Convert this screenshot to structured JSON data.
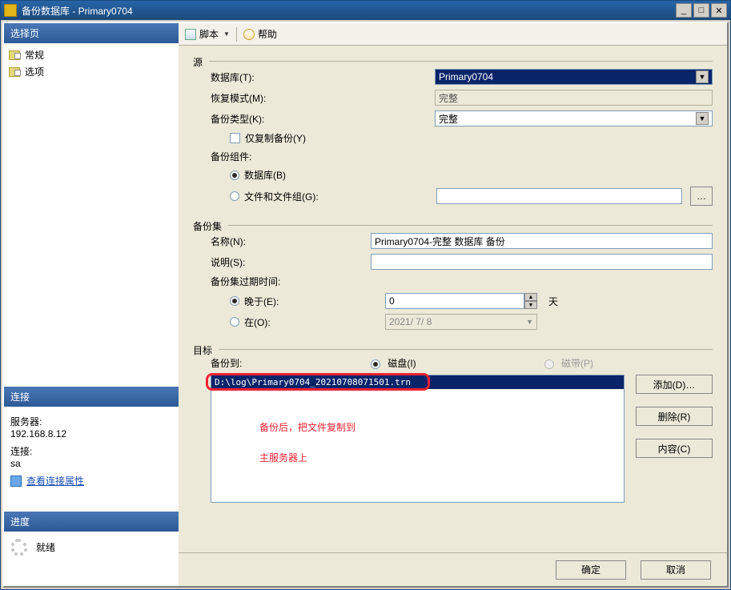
{
  "title": "备份数据库 - Primary0704",
  "toolbar": {
    "script_label": "脚本",
    "help_label": "帮助"
  },
  "left": {
    "select_header": "选择页",
    "nav": {
      "general": "常规",
      "options": "选项"
    },
    "connect_header": "连接",
    "server_label": "服务器:",
    "server_value": "192.168.8.12",
    "conn_label": "连接:",
    "conn_value": "sa",
    "view_props": "查看连接属性",
    "progress_header": "进度",
    "progress_status": "就绪"
  },
  "source": {
    "legend": "源",
    "database_label": "数据库(T):",
    "database_value": "Primary0704",
    "recovery_label": "恢复模式(M):",
    "recovery_value": "完整",
    "backup_type_label": "备份类型(K):",
    "backup_type_value": "完整",
    "copy_only_label": "仅复制备份(Y)",
    "component_label": "备份组件:",
    "component_db": "数据库(B)",
    "component_fg": "文件和文件组(G):"
  },
  "set": {
    "legend": "备份集",
    "name_label": "名称(N):",
    "name_value": "Primary0704-完整 数据库 备份",
    "desc_label": "说明(S):",
    "expire_label": "备份集过期时间:",
    "after_label": "晚于(E):",
    "after_value": "0",
    "after_unit": "天",
    "on_label": "在(O):",
    "on_value": "2021/ 7/ 8"
  },
  "dest": {
    "legend": "目标",
    "backup_to_label": "备份到:",
    "disk_label": "磁盘(I)",
    "tape_label": "磁带(P)",
    "path": "D:\\log\\Primary0704_20210708071501.trn",
    "add_btn": "添加(D)…",
    "remove_btn": "删除(R)",
    "contents_btn": "内容(C)"
  },
  "annotation": {
    "line1": "备份后，把文件复制到",
    "line2": "主服务器上"
  },
  "footer": {
    "ok": "确定",
    "cancel": "取消"
  }
}
